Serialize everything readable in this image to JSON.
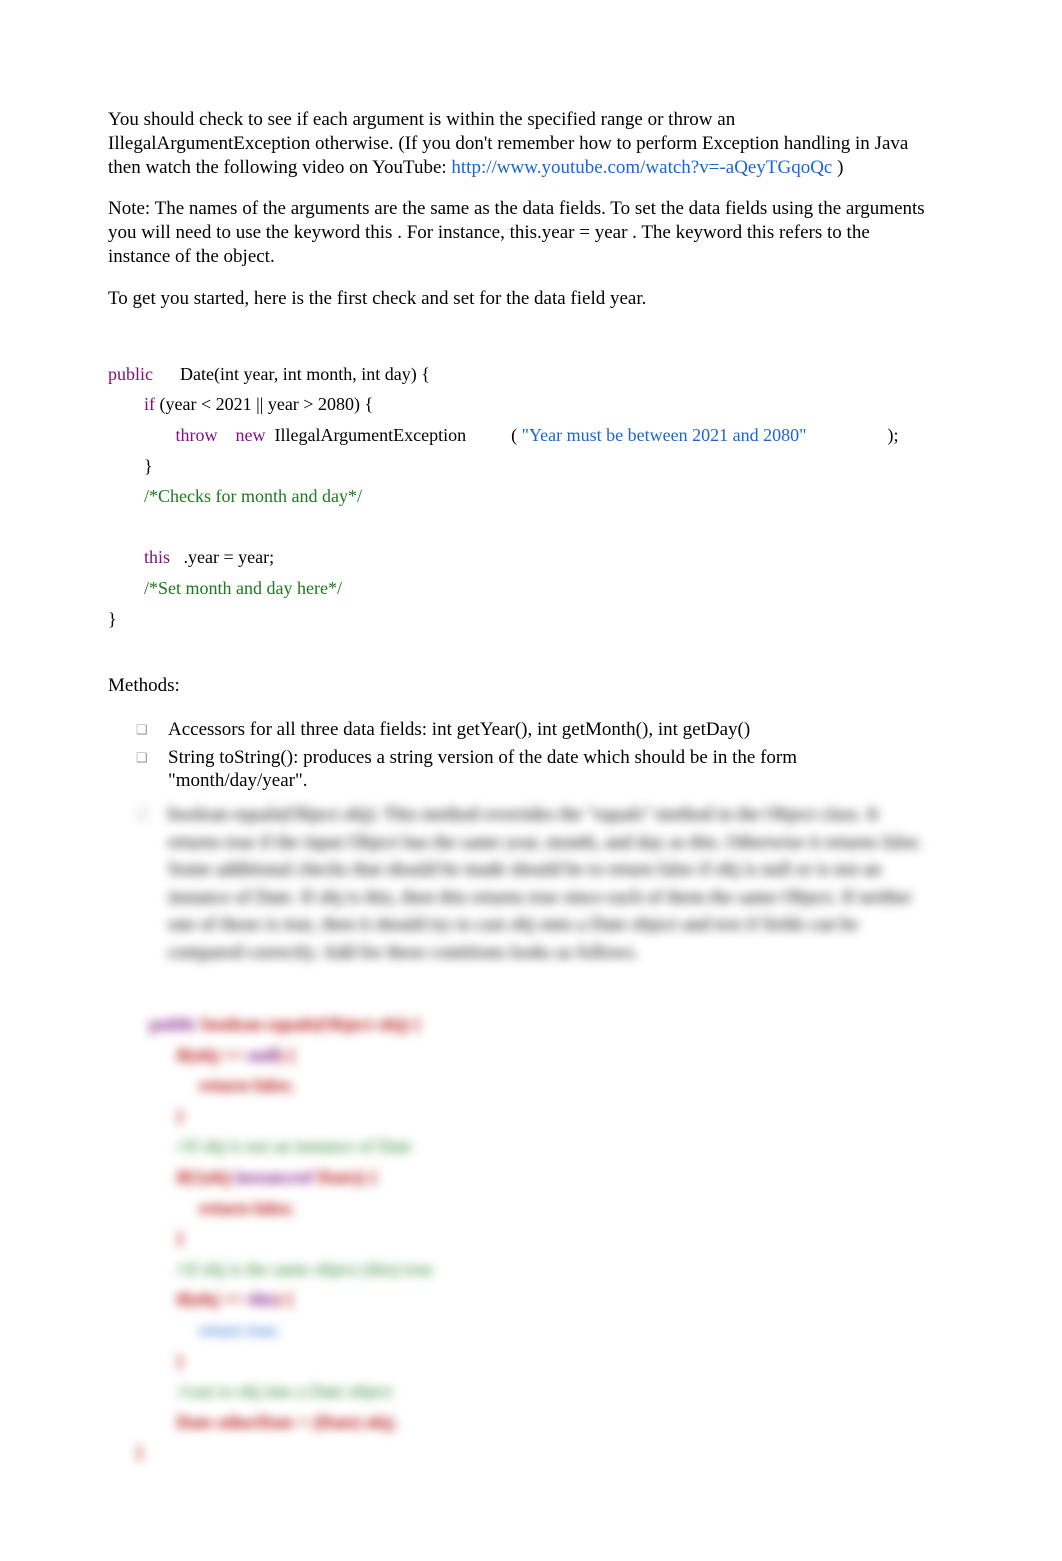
{
  "p1_a": "You should check to see if each argument is within the specified range or throw an IllegalArgumentException otherwise. (If you don't remember how to perform Exception handling in Java then watch the following video on YouTube: ",
  "p1_link": "http://www.youtube.com/watch?v=-aQeyTGqoQc",
  "p1_b": ")",
  "p2_a": "Note: The names of the arguments are the same as the data fields.    To set the data fields using the arguments you will need to use the keyword ",
  "p2_this1": "this",
  "p2_b": ".  For instance, ",
  "p2_thisyear": "this.year = year",
  "p2_c": " .  The keyword this refers to the instance of the object.",
  "p3": "To get you started, here is the first check and set for the data field year.",
  "code": {
    "kw_public": "public",
    "sig": "      Date(int year, int month, int day) {",
    "kw_if": "if",
    "cond": " (year < 2021 || year > 2080) {",
    "kw_throw": "throw",
    "kw_new": "new",
    "exc": "IllegalArgumentException",
    "paren_open": "          ( ",
    "str": "\"Year must be between 2021 and 2080\"",
    "paren_close": "                  );",
    "brace_close1": "        }",
    "comment1": "        /*Checks for month and day*/",
    "blank": "",
    "kw_this": "this",
    "assign": "   .year = year;",
    "comment2": "        /*Set month and day here*/",
    "brace_close2": "}"
  },
  "methods_title": "Methods:",
  "b1_a": "Accessors for all three data fields: ",
  "b1_b": "int getYear(), int getMonth(), int getDay()",
  "b2_a": "String toString():",
  "b2_b": "               produces a string version of the date which should be in the form \"month/day/year\".",
  "blur": {
    "para": "boolean  equals(Object  obj):   This method overrides the \"equals\" method in the Object class.  It returns true if the input Object has the same year, month, and day as this.   Otherwise it returns false.   Some additional checks that should be made should be to return false if obj is null or is not an instance of Date.   If obj is this, then this returns true since each of them the same Object.  If neither one of those is true, then it should try to cast obj onto a Date object and test if fields can be compared correctly.   Add for these contitions looks as follows.",
    "code_l1_kw": "public",
    "code_l1_rest": " boolean equals(Object obj) {",
    "code_l2": "         if(obj == ",
    "code_l2_kw": "null",
    "code_l2_b": ") {",
    "code_l3": "              return false;",
    "code_l4": "         }",
    "code_l5": "         //if obj is not an instance of Date",
    "code_l6": "         if(!(obj ",
    "code_l6_kw": "instanceof",
    "code_l6_b": " Date)) {",
    "code_l7": "              return false;",
    "code_l8": "         }",
    "code_l9": "         //if obj is the same object (this) true",
    "code_l10": "         if(obj == ",
    "code_l10_kw": "this",
    "code_l10_b": ") {",
    "code_l11": "              return true;",
    "code_l12": "         }",
    "code_l13": "         //cast to obj into a Date object",
    "code_l14": "         Date otherDate = (Date) obj;",
    "code_l15": "}"
  }
}
